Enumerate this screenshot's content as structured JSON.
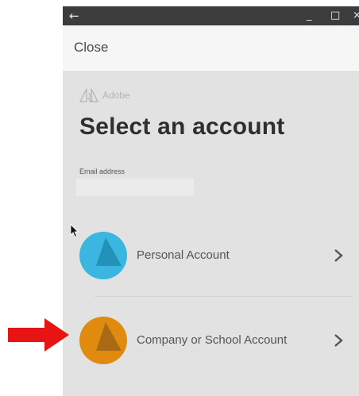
{
  "window": {
    "back_icon": "back-arrow-icon",
    "minimize_glyph": "_",
    "maximize_glyph": "□",
    "close_glyph": "×"
  },
  "header": {
    "close_label": "Close"
  },
  "brand": {
    "name": "Adobe"
  },
  "main": {
    "title": "Select an account",
    "email_label": "Email address",
    "email_value": ""
  },
  "accounts": [
    {
      "label": "Personal Account",
      "color": "#3bb6e0",
      "shade": "#2391b8"
    },
    {
      "label": "Company or School Account",
      "color": "#e08a10",
      "shade": "#a86a12"
    }
  ],
  "colors": {
    "titlebar": "#3a3c3e",
    "background": "#e2e2e2",
    "annotation_arrow": "#e81414"
  }
}
